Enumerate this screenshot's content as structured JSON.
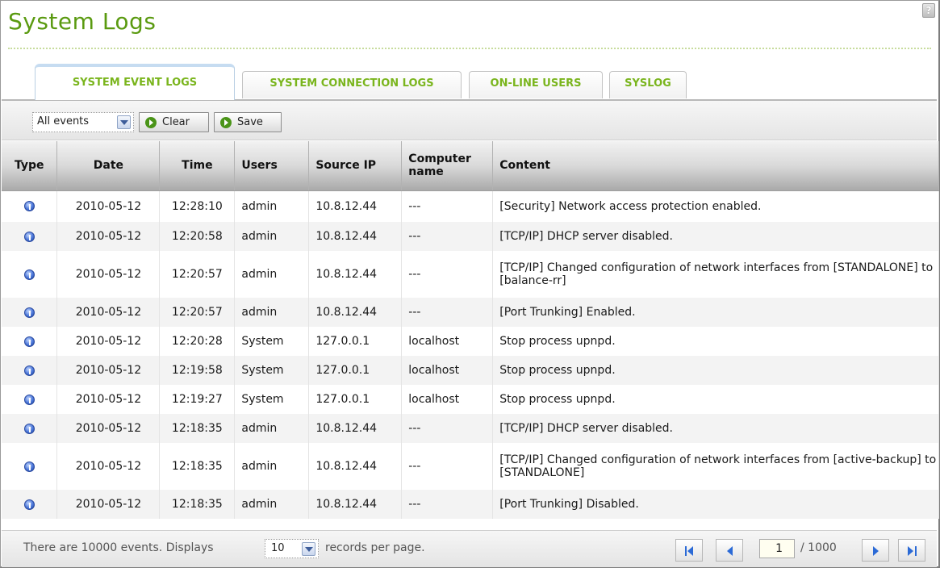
{
  "page": {
    "title": "System Logs"
  },
  "tabs": [
    {
      "label": "SYSTEM EVENT LOGS",
      "active": true
    },
    {
      "label": "SYSTEM CONNECTION LOGS",
      "active": false
    },
    {
      "label": "ON-LINE USERS",
      "active": false
    },
    {
      "label": "SYSLOG",
      "active": false
    }
  ],
  "toolbar": {
    "filter_value": "All events",
    "clear_label": "Clear",
    "save_label": "Save"
  },
  "table": {
    "headers": [
      "Type",
      "Date",
      "Time",
      "Users",
      "Source IP",
      "Computer name",
      "Content"
    ],
    "rows": [
      {
        "type": "info-icon",
        "date": "2010-05-12",
        "time": "12:28:10",
        "user": "admin",
        "ip": "10.8.12.44",
        "computer": "---",
        "content": "[Security] Network access protection enabled."
      },
      {
        "type": "info-icon",
        "date": "2010-05-12",
        "time": "12:20:58",
        "user": "admin",
        "ip": "10.8.12.44",
        "computer": "---",
        "content": "[TCP/IP] DHCP server disabled."
      },
      {
        "type": "info-icon",
        "date": "2010-05-12",
        "time": "12:20:57",
        "user": "admin",
        "ip": "10.8.12.44",
        "computer": "---",
        "content": "[TCP/IP] Changed configuration of network interfaces from [STANDALONE] to [balance-rr]"
      },
      {
        "type": "info-icon",
        "date": "2010-05-12",
        "time": "12:20:57",
        "user": "admin",
        "ip": "10.8.12.44",
        "computer": "---",
        "content": "[Port Trunking] Enabled."
      },
      {
        "type": "info-icon",
        "date": "2010-05-12",
        "time": "12:20:28",
        "user": "System",
        "ip": "127.0.0.1",
        "computer": "localhost",
        "content": "Stop process upnpd."
      },
      {
        "type": "info-icon",
        "date": "2010-05-12",
        "time": "12:19:58",
        "user": "System",
        "ip": "127.0.0.1",
        "computer": "localhost",
        "content": "Stop process upnpd."
      },
      {
        "type": "info-icon",
        "date": "2010-05-12",
        "time": "12:19:27",
        "user": "System",
        "ip": "127.0.0.1",
        "computer": "localhost",
        "content": "Stop process upnpd."
      },
      {
        "type": "info-icon",
        "date": "2010-05-12",
        "time": "12:18:35",
        "user": "admin",
        "ip": "10.8.12.44",
        "computer": "---",
        "content": "[TCP/IP] DHCP server disabled."
      },
      {
        "type": "info-icon",
        "date": "2010-05-12",
        "time": "12:18:35",
        "user": "admin",
        "ip": "10.8.12.44",
        "computer": "---",
        "content": "[TCP/IP] Changed configuration of network interfaces from [active-backup] to [STANDALONE]"
      },
      {
        "type": "info-icon",
        "date": "2010-05-12",
        "time": "12:18:35",
        "user": "admin",
        "ip": "10.8.12.44",
        "computer": "---",
        "content": "[Port Trunking] Disabled."
      }
    ]
  },
  "footer": {
    "summary_prefix": "There are 10000 events. Displays",
    "per_page_value": "10",
    "summary_suffix": "records per page.",
    "current_page": "1",
    "total_pages": "/ 1000"
  }
}
